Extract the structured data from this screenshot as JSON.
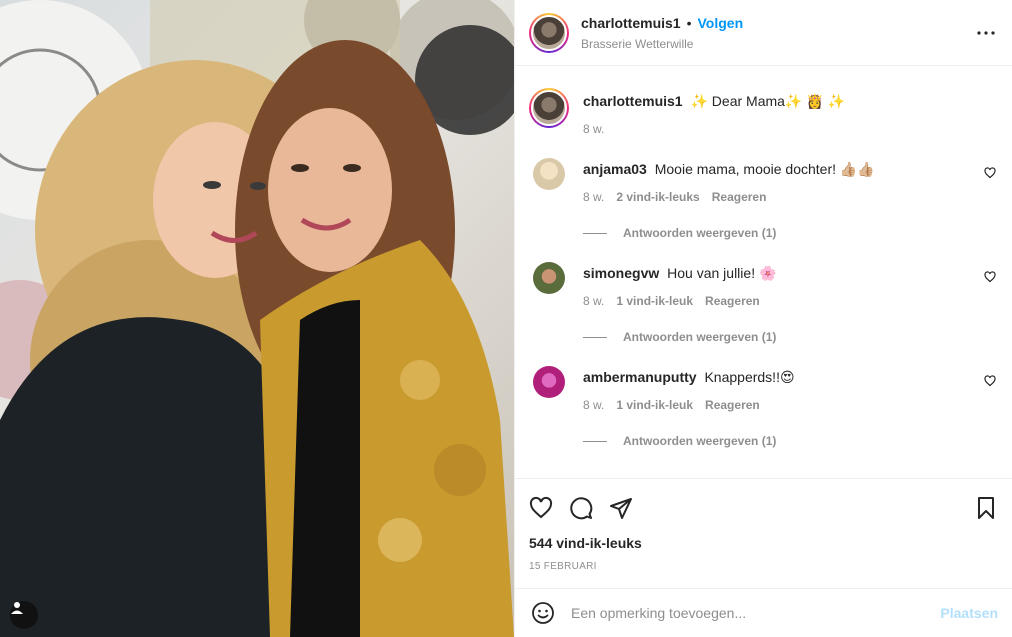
{
  "post": {
    "username": "charlottemuis1",
    "follow_label": "Volgen",
    "separator": "•",
    "location": "Brasserie Wetterwille",
    "more_icon": "more-horizontal-icon"
  },
  "caption": {
    "username": "charlottemuis1",
    "text": "✨ Dear Mama✨ 👸 ✨",
    "time": "8 w."
  },
  "comments": [
    {
      "username": "anjama03",
      "text": "Mooie mama, mooie dochter! 👍🏼👍🏼",
      "time": "8 w.",
      "likes": "2 vind-ik-leuks",
      "reply": "Reageren",
      "view_replies": "Antwoorden weergeven (1)",
      "avatar_color": "#d9c9a8"
    },
    {
      "username": "simonegvw",
      "text": "Hou van jullie! 🌸",
      "time": "8 w.",
      "likes": "1 vind-ik-leuk",
      "reply": "Reageren",
      "view_replies": "Antwoorden weergeven (1)",
      "avatar_color": "#5a6b3c"
    },
    {
      "username": "ambermanuputty",
      "text": "Knapperds!!😍",
      "time": "8 w.",
      "likes": "1 vind-ik-leuk",
      "reply": "Reageren",
      "view_replies": "Antwoorden weergeven (1)",
      "avatar_color": "#b0207a"
    }
  ],
  "actions": {
    "likes_count": "544 vind-ik-leuks",
    "date": "15 FEBRUARI"
  },
  "add_comment": {
    "placeholder": "Een opmerking toevoegen...",
    "post_label": "Plaatsen"
  },
  "colors": {
    "accent": "#0095f6",
    "post_button_disabled": "#b2dffc",
    "secondary_text": "#8e8e8e"
  }
}
